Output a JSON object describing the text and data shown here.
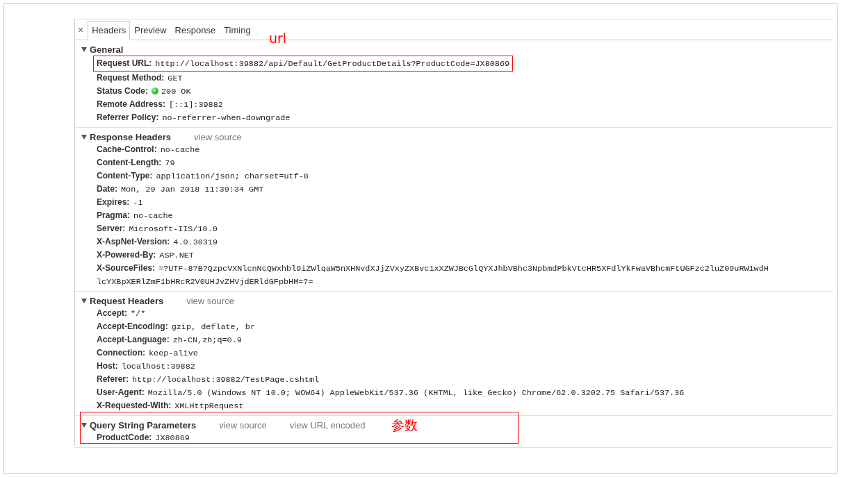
{
  "close_glyph": "×",
  "tabs": [
    {
      "label": "Headers",
      "selected": true
    },
    {
      "label": "Preview",
      "selected": false
    },
    {
      "label": "Response",
      "selected": false
    },
    {
      "label": "Timing",
      "selected": false
    }
  ],
  "sections": [
    {
      "title": "General",
      "expanded": true,
      "highlighted": false,
      "rows": [
        {
          "kind": "plain",
          "name": "Request URL:",
          "value": "http://localhost:39882/api/Default/GetProductDetails?ProductCode=JX80869",
          "highlighted": true,
          "note": "url"
        },
        {
          "kind": "plain",
          "name": "Request Method:",
          "value": "GET",
          "highlighted": false
        },
        {
          "kind": "status",
          "name": "Status Code:",
          "value": "200 OK",
          "highlighted": false
        },
        {
          "kind": "plain",
          "name": "Remote Address:",
          "value": "[::1]:39882",
          "highlighted": false
        },
        {
          "kind": "plain",
          "name": "Referrer Policy:",
          "value": "no-referrer-when-downgrade",
          "highlighted": false
        }
      ]
    },
    {
      "title": "Response Headers",
      "expanded": true,
      "highlighted": false,
      "links": [
        "view source"
      ],
      "rows": [
        {
          "kind": "plain",
          "name": "Cache-Control:",
          "value": "no-cache",
          "highlighted": false
        },
        {
          "kind": "plain",
          "name": "Content-Length:",
          "value": "79",
          "highlighted": false
        },
        {
          "kind": "plain",
          "name": "Content-Type:",
          "value": "application/json; charset=utf-8",
          "highlighted": false
        },
        {
          "kind": "plain",
          "name": "Date:",
          "value": "Mon, 29 Jan 2018 11:39:34 GMT",
          "highlighted": false
        },
        {
          "kind": "plain",
          "name": "Expires:",
          "value": "-1",
          "highlighted": false
        },
        {
          "kind": "plain",
          "name": "Pragma:",
          "value": "no-cache",
          "highlighted": false
        },
        {
          "kind": "plain",
          "name": "Server:",
          "value": "Microsoft-IIS/10.0",
          "highlighted": false
        },
        {
          "kind": "plain",
          "name": "X-AspNet-Version:",
          "value": "4.0.30319",
          "highlighted": false
        },
        {
          "kind": "plain",
          "name": "X-Powered-By:",
          "value": "ASP.NET",
          "highlighted": false
        },
        {
          "kind": "plain",
          "name": "X-SourceFiles:",
          "value": "=?UTF-8?B?QzpcVXNlcnNcQWxhbl9iZWlqaW5nXHNvdXJjZVxyZXBvc1xXZWJBcGlQYXJhbVBhc3NpbmdPbkVtcHR5XFdlYkFwaVBhcmFtUGFzc2luZ09uRW1wdH",
          "continuation": "lcYXBpXERlZmF1bHRcR2V0UHJvZHVjdERldGFpbHM=?=",
          "highlighted": false
        }
      ]
    },
    {
      "title": "Request Headers",
      "expanded": true,
      "highlighted": false,
      "links": [
        "view source"
      ],
      "rows": [
        {
          "kind": "plain",
          "name": "Accept:",
          "value": "*/*",
          "highlighted": false
        },
        {
          "kind": "plain",
          "name": "Accept-Encoding:",
          "value": "gzip, deflate, br",
          "highlighted": false
        },
        {
          "kind": "plain",
          "name": "Accept-Language:",
          "value": "zh-CN,zh;q=0.9",
          "highlighted": false
        },
        {
          "kind": "plain",
          "name": "Connection:",
          "value": "keep-alive",
          "highlighted": false
        },
        {
          "kind": "plain",
          "name": "Host:",
          "value": "localhost:39882",
          "highlighted": false
        },
        {
          "kind": "plain",
          "name": "Referer:",
          "value": "http://localhost:39882/TestPage.cshtml",
          "highlighted": false
        },
        {
          "kind": "plain",
          "name": "User-Agent:",
          "value": "Mozilla/5.0 (Windows NT 10.0; WOW64) AppleWebKit/537.36 (KHTML, like Gecko) Chrome/62.0.3202.75 Safari/537.36",
          "highlighted": false
        },
        {
          "kind": "plain",
          "name": "X-Requested-With:",
          "value": "XMLHttpRequest",
          "highlighted": false
        }
      ]
    },
    {
      "title": "Query String Parameters",
      "expanded": true,
      "highlighted": true,
      "note": "参数",
      "links": [
        "view source",
        "view URL encoded"
      ],
      "rows": [
        {
          "kind": "plain",
          "name": "ProductCode:",
          "value": "JX80869",
          "highlighted": false
        }
      ]
    }
  ]
}
